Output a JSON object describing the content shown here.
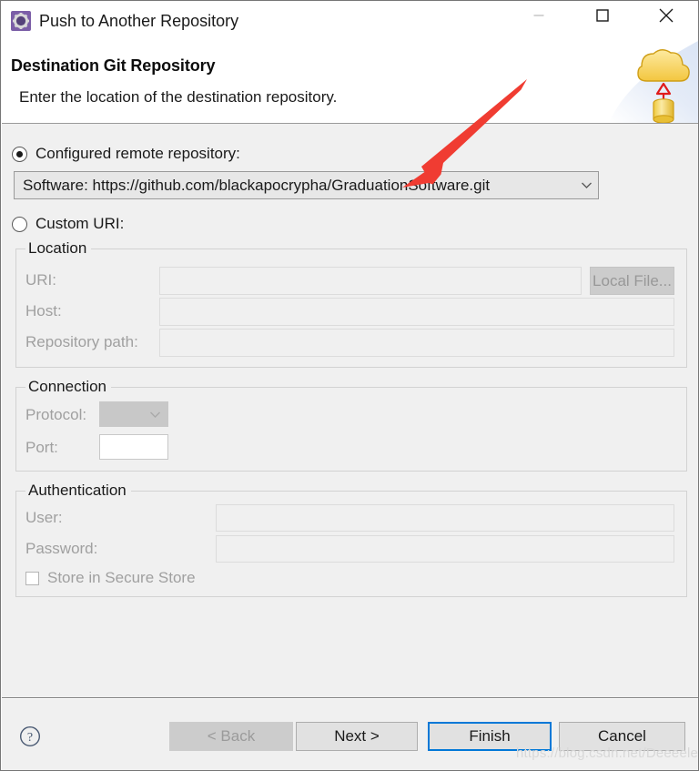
{
  "window": {
    "title": "Push to Another Repository",
    "icon": "gear-icon",
    "controls": {
      "minimize": "minimize-icon",
      "maximize": "maximize-icon",
      "close": "close-icon"
    }
  },
  "header": {
    "title": "Destination Git Repository",
    "description": "Enter the location of the destination repository.",
    "art_icon": "push-to-cloud-icon"
  },
  "main": {
    "configured_remote": {
      "label": "Configured remote repository:",
      "selected": true,
      "value": "Software: https://github.com/blackapocrypha/GraduationSoftware.git"
    },
    "custom_uri": {
      "label": "Custom URI:",
      "selected": false
    },
    "location": {
      "title": "Location",
      "uri_label": "URI:",
      "uri_value": "",
      "local_file_button": "Local File...",
      "host_label": "Host:",
      "host_value": "",
      "repository_path_label": "Repository path:",
      "repository_path_value": ""
    },
    "connection": {
      "title": "Connection",
      "protocol_label": "Protocol:",
      "protocol_value": "",
      "port_label": "Port:",
      "port_value": ""
    },
    "authentication": {
      "title": "Authentication",
      "user_label": "User:",
      "user_value": "",
      "password_label": "Password:",
      "password_value": "",
      "store_secure_label": "Store in Secure Store",
      "store_secure_checked": false
    }
  },
  "footer": {
    "help_icon": "help-icon",
    "back": "< Back",
    "next": "Next >",
    "finish": "Finish",
    "cancel": "Cancel"
  },
  "annotation": {
    "arrow_color": "#f03c32"
  },
  "watermark": "https://blog.csdn.net/Deeeelete",
  "colors": {
    "accent": "#0078d7",
    "dialog_bg": "#f0f0f0",
    "header_bg": "#ffffff",
    "arrow": "#f03c32",
    "icon_purple": "#7b5ea7",
    "cloud_yellow": "#f7d560"
  }
}
